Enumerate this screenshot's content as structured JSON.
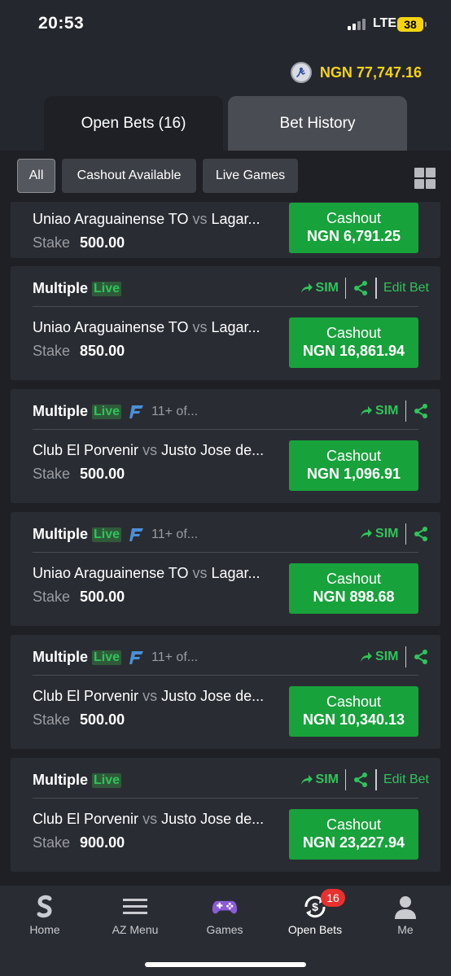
{
  "status": {
    "time": "20:53",
    "network": "LTE",
    "battery": "38"
  },
  "balance": {
    "amount": "NGN 77,747.16"
  },
  "tabs": [
    {
      "label": "Open Bets (16)"
    },
    {
      "label": "Bet History"
    }
  ],
  "filters": [
    {
      "label": "All"
    },
    {
      "label": "Cashout Available"
    },
    {
      "label": "Live Games"
    }
  ],
  "labels": {
    "stake": "Stake",
    "cashout": "Cashout",
    "vs": "vs",
    "sim": "SIM",
    "edit_bet": "Edit Bet",
    "live": "Live"
  },
  "bets": [
    {
      "title": "",
      "match_home": "Uniao Araguainense TO",
      "match_away": "Lagar...",
      "stake": "500.00",
      "cashout_amount": "NGN 6,791.25"
    },
    {
      "title": "Multiple",
      "extra": "",
      "match_home": "Uniao Araguainense TO",
      "match_away": "Lagar...",
      "stake": "850.00",
      "cashout_amount": "NGN 16,861.94"
    },
    {
      "title": "Multiple",
      "extra": "11+ of...",
      "match_home": "Club El Porvenir",
      "match_away": "Justo Jose de...",
      "stake": "500.00",
      "cashout_amount": "NGN 1,096.91"
    },
    {
      "title": "Multiple",
      "extra": "11+ of...",
      "match_home": "Uniao Araguainense TO",
      "match_away": "Lagar...",
      "stake": "500.00",
      "cashout_amount": "NGN 898.68"
    },
    {
      "title": "Multiple",
      "extra": "11+ of...",
      "match_home": "Club El Porvenir",
      "match_away": "Justo Jose de...",
      "stake": "500.00",
      "cashout_amount": "NGN 10,340.13"
    },
    {
      "title": "Multiple",
      "extra": "",
      "match_home": "Club El Porvenir",
      "match_away": "Justo Jose de...",
      "stake": "900.00",
      "cashout_amount": "NGN 23,227.94"
    }
  ],
  "nav": [
    {
      "label": "Home"
    },
    {
      "label": "AZ Menu"
    },
    {
      "label": "Games"
    },
    {
      "label": "Open Bets",
      "badge": "16"
    },
    {
      "label": "Me"
    }
  ],
  "colors": {
    "accent_green": "#18a23b",
    "live_green": "#2fc45a",
    "balance_yellow": "#f5d40f",
    "badge_red": "#e8312e"
  }
}
